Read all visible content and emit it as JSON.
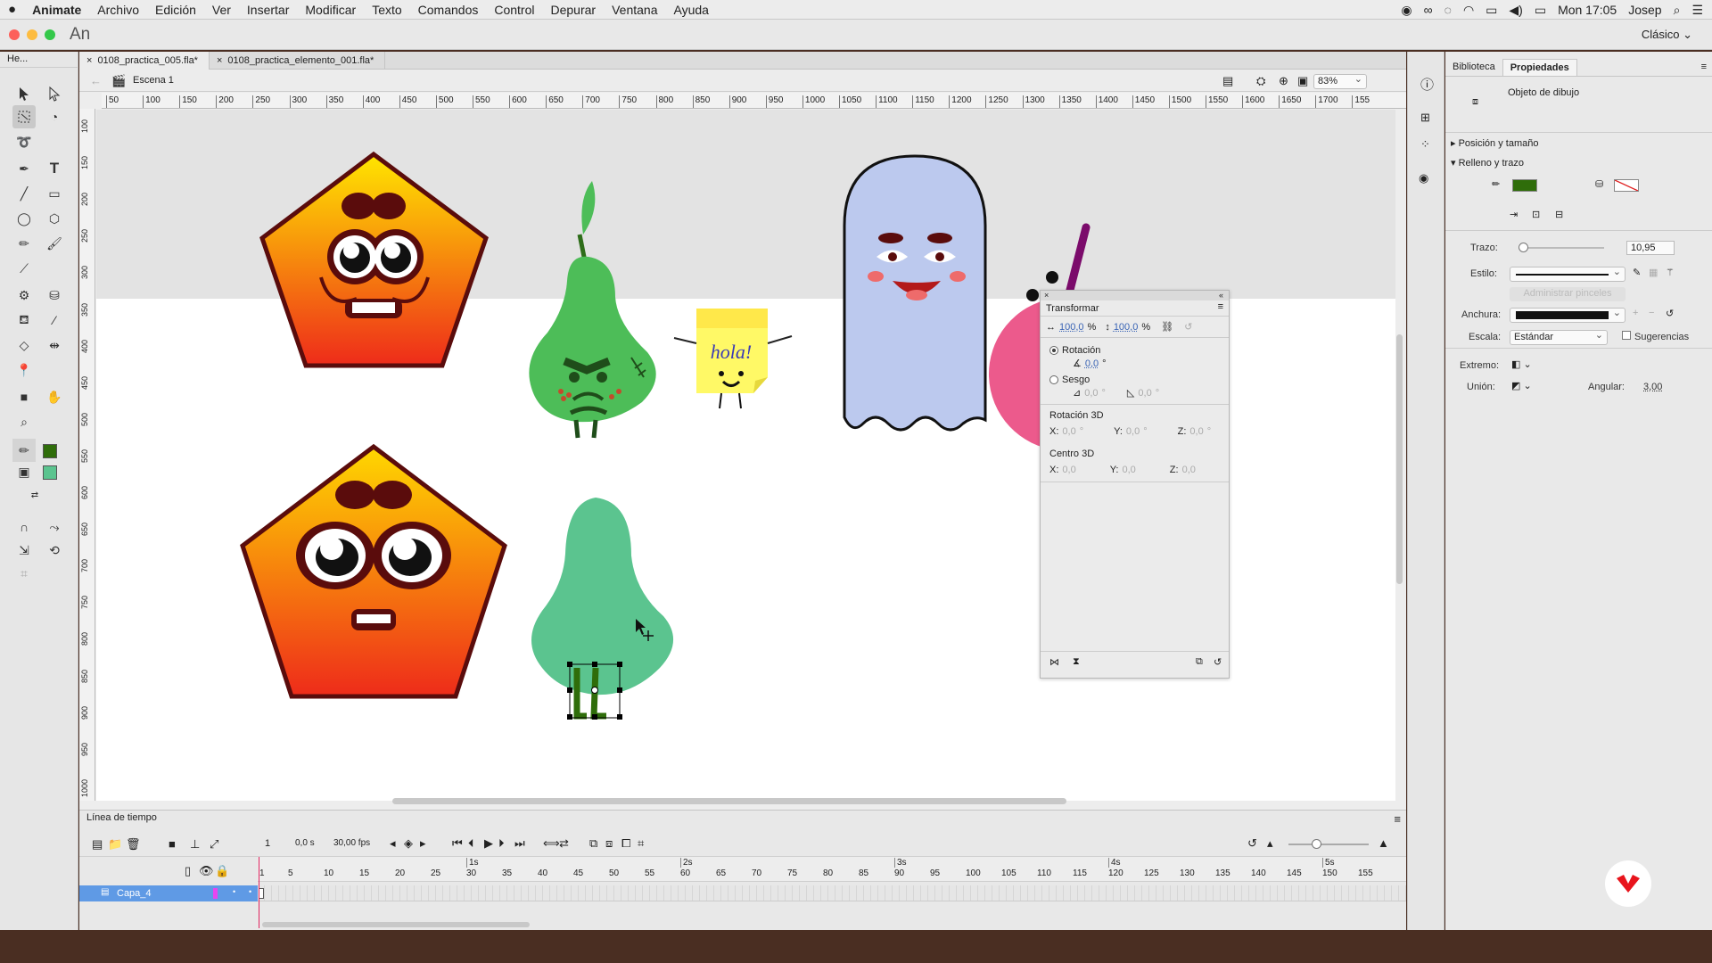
{
  "menubar": {
    "apple": "",
    "app": "Animate",
    "items": [
      "Archivo",
      "Edición",
      "Ver",
      "Insertar",
      "Modificar",
      "Texto",
      "Comandos",
      "Control",
      "Depurar",
      "Ventana",
      "Ayuda"
    ],
    "clock": "Mon 17:05",
    "user": "Josep"
  },
  "titlebar": {
    "logo": "An",
    "workspace": "Clásico"
  },
  "tools": {
    "panel_label": "He..."
  },
  "document": {
    "tabs": [
      {
        "label": "0108_practica_005.fla*",
        "active": true
      },
      {
        "label": "0108_practica_elemento_001.fla*",
        "active": false
      }
    ],
    "scene": "Escena 1",
    "zoom": "83%",
    "ruler_h": [
      "50",
      "100",
      "150",
      "200",
      "250",
      "300",
      "350",
      "400",
      "450",
      "500",
      "550",
      "600",
      "650",
      "700",
      "750",
      "800",
      "850",
      "900",
      "950",
      "1000",
      "1050",
      "1100",
      "1150",
      "1200",
      "1250",
      "1300",
      "1350",
      "1400",
      "1450",
      "1500",
      "1550",
      "1600",
      "1650",
      "1700",
      "155"
    ],
    "ruler_v": [
      "100",
      "150",
      "200",
      "250",
      "300",
      "350",
      "400",
      "450",
      "500",
      "550",
      "600",
      "650",
      "700",
      "750",
      "800",
      "850",
      "900",
      "950",
      "1000"
    ],
    "postit_text": "hola!"
  },
  "transform": {
    "title": "Transformar",
    "scale_w": "100,0",
    "scale_h": "100,0",
    "percent": "%",
    "rotation_label": "Rotación",
    "rotation_value": "0,0",
    "skew_label": "Sesgo",
    "skew_h": "0,0",
    "skew_v": "0,0",
    "deg": "°",
    "rot3d_label": "Rotación 3D",
    "center3d_label": "Centro 3D",
    "x": "X:",
    "y": "Y:",
    "z": "Z:",
    "rot3d_vals": [
      "0,0",
      "0,0",
      "0,0"
    ],
    "center3d_vals": [
      "0,0",
      "0,0",
      "0,0"
    ]
  },
  "properties": {
    "tabs": [
      "Biblioteca",
      "Propiedades"
    ],
    "object_type": "Objeto de dibujo",
    "section_pos": "Posición y tamaño",
    "section_fill": "Relleno y trazo",
    "stroke_color": "#2f6d0a",
    "trazo_label": "Trazo:",
    "trazo_value": "10,95",
    "estilo_label": "Estilo:",
    "manage_brushes": "Administrar pinceles",
    "anchura_label": "Anchura:",
    "escala_label": "Escala:",
    "escala_value": "Estándar",
    "hints_label": "Sugerencias",
    "extremo_label": "Extremo:",
    "union_label": "Unión:",
    "angular_label": "Angular:",
    "angular_value": "3,00"
  },
  "timeline": {
    "title": "Línea de tiempo",
    "frame": "1",
    "time": "0,0 s",
    "fps": "30,00 fps",
    "layer": "Capa_4",
    "seconds": [
      "1s",
      "2s",
      "3s",
      "4s",
      "5s"
    ],
    "frame_numbers": [
      "1",
      "5",
      "10",
      "15",
      "20",
      "25",
      "30",
      "35",
      "40",
      "45",
      "50",
      "55",
      "60",
      "65",
      "70",
      "75",
      "80",
      "85",
      "90",
      "95",
      "100",
      "105",
      "110",
      "115",
      "120",
      "125",
      "130",
      "135",
      "140",
      "145",
      "150",
      "155"
    ]
  }
}
